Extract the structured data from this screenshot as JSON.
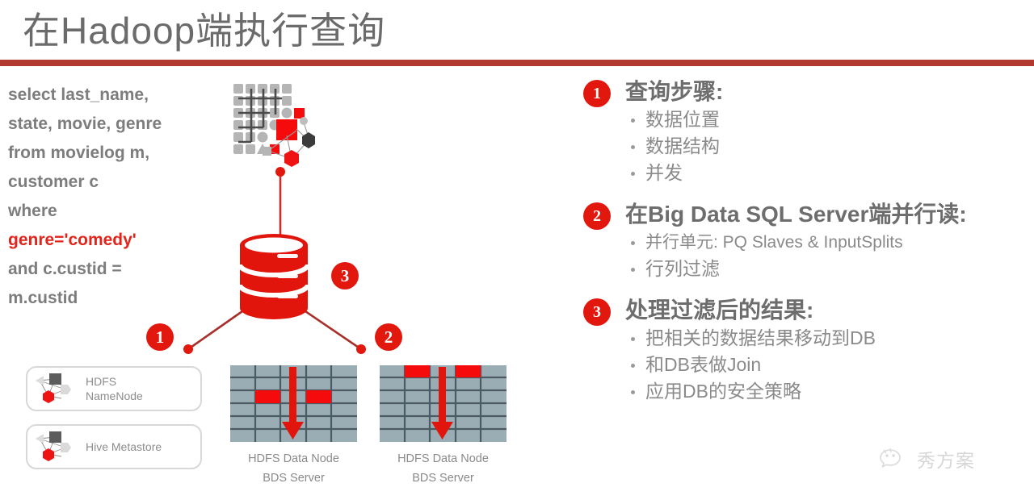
{
  "slide": {
    "title": "在Hadoop端执行查询",
    "rule_color": "#b2392f",
    "accent_color": "#e2180f"
  },
  "sql": {
    "lines": [
      "select last_name,",
      "state, movie, genre",
      "from movielog m,",
      "customer c",
      "where"
    ],
    "highlight_line": "genre='comedy'",
    "lines_after": [
      "and c.custid =",
      "m.custid"
    ]
  },
  "diagram": {
    "cluster_icon_name": "hadoop-cluster-graph-icon",
    "database_icon_name": "database-cylinder-icon",
    "badges": {
      "one": "1",
      "two": "2",
      "three": "3"
    },
    "meta_boxes": [
      {
        "label_line1": "HDFS",
        "label_line2": "NameNode",
        "icon": "node-graph-icon"
      },
      {
        "label_line1": "Hive Metastore",
        "label_line2": "",
        "icon": "node-graph-icon"
      }
    ],
    "data_nodes": [
      {
        "label_line1": "HDFS Data Node",
        "label_line2": "BDS Server"
      },
      {
        "label_line1": "HDFS Data Node",
        "label_line2": "BDS Server"
      }
    ]
  },
  "right_column": {
    "sections": [
      {
        "badge": "1",
        "heading": "查询步骤:",
        "bullets": [
          "数据位置",
          "数据结构",
          "并发"
        ]
      },
      {
        "badge": "2",
        "heading": "在Big Data SQL Server端并行读:",
        "bullets": [
          "并行单元: PQ Slaves & InputSplits",
          "行列过滤"
        ]
      },
      {
        "badge": "3",
        "heading": "处理过滤后的结果:",
        "bullets": [
          "把相关的数据结果移动到DB",
          "和DB表做Join",
          "应用DB的安全策略"
        ]
      }
    ]
  },
  "watermark": {
    "text": "秀方案",
    "icon": "wechat-bubble-icon"
  }
}
